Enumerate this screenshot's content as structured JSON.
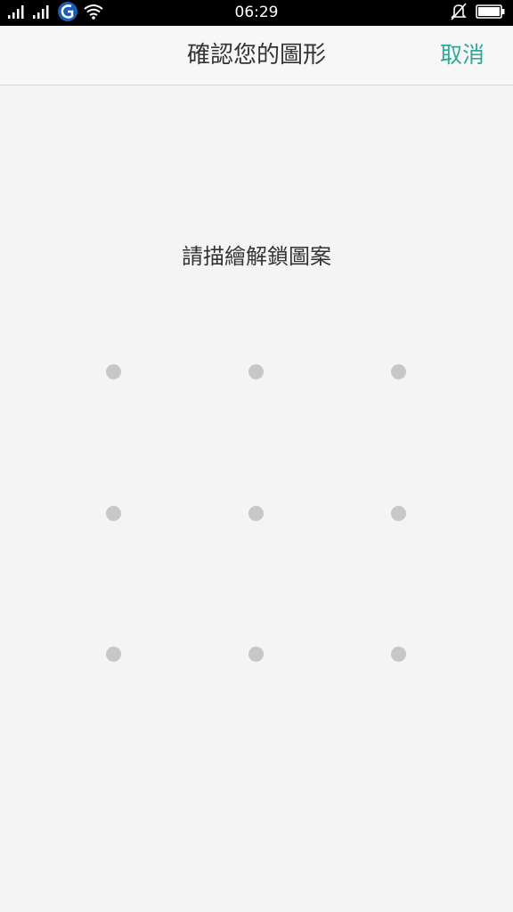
{
  "status_bar": {
    "time": "06:29",
    "icons": [
      "signal-icon",
      "signal-icon-2",
      "carrier-logo-icon",
      "wifi-icon",
      "silent-bell-icon",
      "battery-icon"
    ]
  },
  "header": {
    "title": "確認您的圖形",
    "cancel_label": "取消"
  },
  "instruction": "請描繪解鎖圖案",
  "pattern": {
    "rows": 3,
    "cols": 3,
    "dots": [
      1,
      2,
      3,
      4,
      5,
      6,
      7,
      8,
      9
    ]
  },
  "colors": {
    "accent": "#2fa89a",
    "dot": "#c6c6cc",
    "background": "#f4f4f4"
  }
}
